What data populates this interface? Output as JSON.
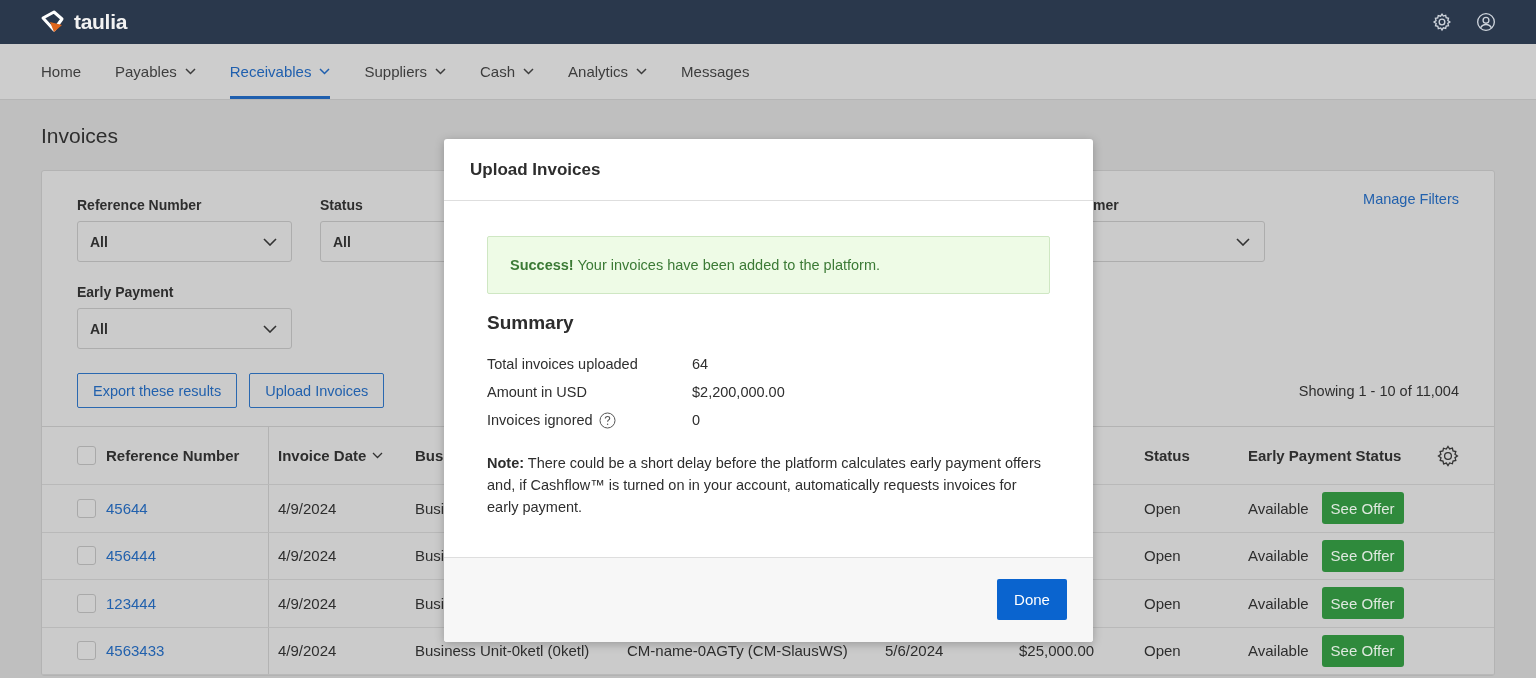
{
  "app": {
    "logo": "taulia"
  },
  "nav": [
    {
      "label": "Home",
      "dropdown": false,
      "selected": false
    },
    {
      "label": "Payables",
      "dropdown": true,
      "selected": false
    },
    {
      "label": "Receivables",
      "dropdown": true,
      "selected": true
    },
    {
      "label": "Suppliers",
      "dropdown": true,
      "selected": false
    },
    {
      "label": "Cash",
      "dropdown": true,
      "selected": false
    },
    {
      "label": "Analytics",
      "dropdown": true,
      "selected": false
    },
    {
      "label": "Messages",
      "dropdown": false,
      "selected": false
    }
  ],
  "page_title": "Invoices",
  "filters": {
    "manage_link": "Manage Filters",
    "row_1": [
      {
        "label": "Reference Number",
        "value": "All"
      },
      {
        "label": "Status",
        "value": "All"
      }
    ],
    "right": {
      "label": "mer"
    },
    "row_2": [
      {
        "label": "Early Payment",
        "value": "All"
      }
    ]
  },
  "actions": [
    "Export these results",
    "Upload Invoices"
  ],
  "result_count": "Showing 1 - 10 of 11,004",
  "table": {
    "header_checked": false,
    "columns": [
      {
        "label": "Reference Number",
        "sorted": false
      },
      {
        "label": "Invoice Date",
        "sorted": true
      },
      {
        "label": "Bus",
        "sorted": false
      },
      {
        "label": "Status",
        "sorted": false
      },
      {
        "label": "Early Payment Status",
        "sorted": false
      }
    ],
    "rows": [
      {
        "checked": false,
        "reference": "45644",
        "invoice_date": "4/9/2024",
        "business": "Busi",
        "status": "Open",
        "early_payment": "Available",
        "action": "See Offer"
      },
      {
        "checked": false,
        "reference": "456444",
        "invoice_date": "4/9/2024",
        "business": "Busi",
        "status": "Open",
        "early_payment": "Available",
        "action": "See Offer"
      },
      {
        "checked": false,
        "reference": "123444",
        "invoice_date": "4/9/2024",
        "business": "Busi",
        "status": "Open",
        "early_payment": "Available",
        "action": "See Offer"
      },
      {
        "checked": false,
        "reference": "4563433",
        "invoice_date": "4/9/2024",
        "business": "Business Unit-0ketl (0ketl)",
        "customer": "CM-name-0AGTy (CM-SlausWS)",
        "due_date": "5/6/2024",
        "amount": "$25,000.00",
        "status": "Open",
        "early_payment": "Available",
        "action": "See Offer"
      }
    ]
  },
  "modal": {
    "title": "Upload Invoices",
    "success": "**Success!** Your invoices have been added to the platform.",
    "summary_title": "Summary",
    "summary": [
      {
        "label": "Total invoices uploaded",
        "value": "64",
        "help": false
      },
      {
        "label": "Amount in USD",
        "value": "$2,200,000.00",
        "help": false
      },
      {
        "label": "Invoices ignored",
        "value": "0",
        "help": true
      }
    ],
    "note": "**Note:** There could be a short delay before the platform calculates early payment offers and, if Cashflow™ is turned on in your account, automatically requests invoices for early payment.",
    "button": "Done"
  }
}
